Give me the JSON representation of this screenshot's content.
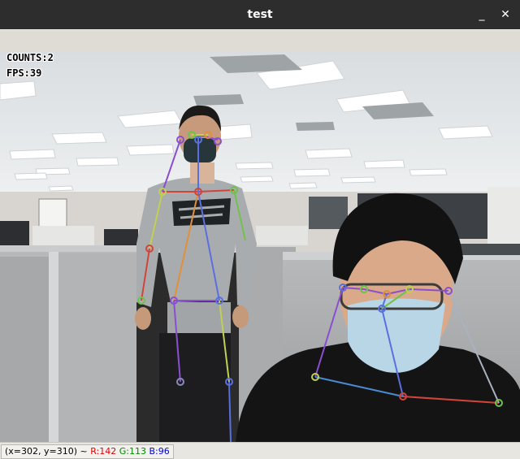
{
  "window": {
    "title": "test",
    "minimize_glyph": "_",
    "close_glyph": "✕"
  },
  "overlay": {
    "counts": "COUNTS:2",
    "fps": "FPS:39"
  },
  "status": {
    "coords": "(x=302, y=310) ~",
    "r_text": "R:142",
    "g_text": "G:113",
    "b_text": "B:96"
  },
  "colors": {
    "titlebar": "#2d2d2d",
    "toolbar": "#dfdcd6",
    "skeleton_blue": "#5a6fe0",
    "skeleton_green": "#6fc24a",
    "skeleton_purple": "#8a4fd0",
    "skeleton_red": "#d0453a",
    "skeleton_orange": "#e0903a"
  }
}
